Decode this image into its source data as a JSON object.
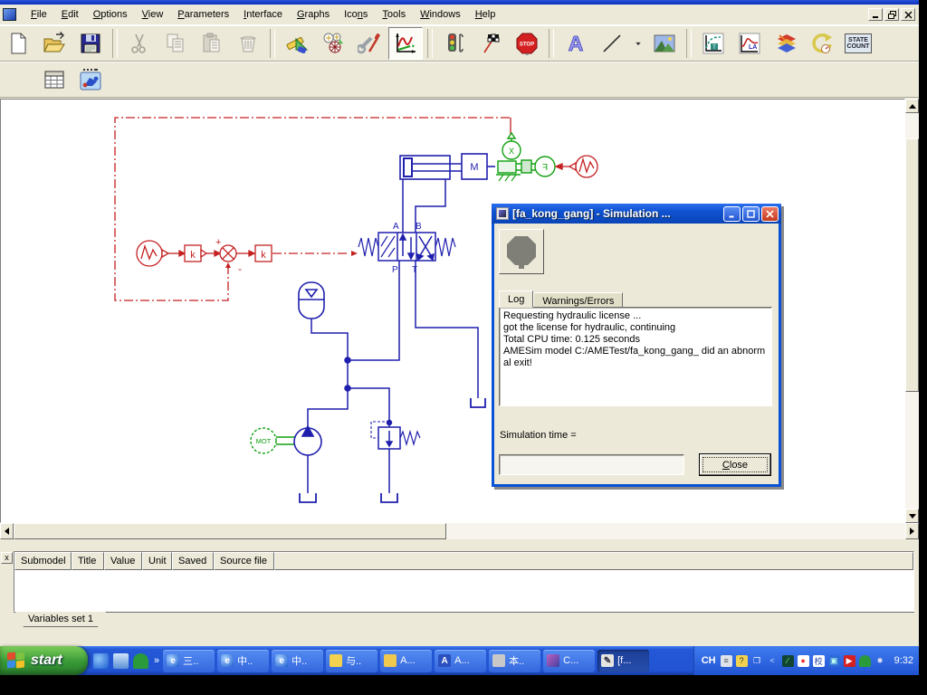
{
  "menu": {
    "items": [
      {
        "label": "File",
        "u": 0
      },
      {
        "label": "Edit",
        "u": 0
      },
      {
        "label": "Options",
        "u": 0
      },
      {
        "label": "View",
        "u": 0
      },
      {
        "label": "Parameters",
        "u": 0
      },
      {
        "label": "Interface",
        "u": 0
      },
      {
        "label": "Graphs",
        "u": 0
      },
      {
        "label": "Icons",
        "u": 3
      },
      {
        "label": "Tools",
        "u": 0
      },
      {
        "label": "Windows",
        "u": 0
      },
      {
        "label": "Help",
        "u": 0
      }
    ]
  },
  "toolbar_main": {
    "buttons": [
      "new",
      "open",
      "save",
      "sep",
      "cut",
      "copy",
      "paste",
      "delete",
      "sep",
      "sketch-mode",
      "submodel-mode",
      "parameter-mode",
      "run-mode",
      "sep",
      "start-run",
      "run-flag",
      "stop",
      "sep",
      "text-tool",
      "line-tool",
      "line-dropdown",
      "image-tool",
      "sep",
      "plot-temporal",
      "plot-linear",
      "cross-results",
      "rewatch",
      "state-count"
    ]
  },
  "toolbar_secondary": {
    "buttons": [
      "plot",
      "table",
      "animation"
    ]
  },
  "toolbar_labels": {
    "stop": "STOP",
    "text_tool": "A",
    "state_count": "STATE COUNT"
  },
  "dialog": {
    "title": "[fa_kong_gang] - Simulation ...",
    "tabs": {
      "0": {
        "label": "Log"
      },
      "1": {
        "label": "Warnings/Errors"
      }
    },
    "log_lines": [
      "Requesting hydraulic license ...",
      "got the license for hydraulic, continuing",
      "Total CPU time: 0.125 seconds",
      "AMESim model C:/AMETest/fa_kong_gang_ did an abnorm",
      "al exit!"
    ],
    "simulation_time_label": "Simulation time =",
    "simulation_time_value": "",
    "close_label": "Close",
    "close_underline": 0
  },
  "bottom_panel": {
    "columns": [
      "Submodel",
      "Title",
      "Value",
      "Unit",
      "Saved",
      "Source file"
    ],
    "tab": "Variables set 1",
    "close_glyph": "x"
  },
  "taskbar": {
    "start_label": "start",
    "quick_launch": [
      "ie",
      "mail",
      "umbrella"
    ],
    "chevron": "»",
    "tasks": [
      {
        "icon": "ie",
        "label": "三..",
        "active": false
      },
      {
        "icon": "ie",
        "label": "中..",
        "active": false
      },
      {
        "icon": "ie",
        "label": "中..",
        "active": false
      },
      {
        "icon": "notes",
        "label": "与..",
        "active": false
      },
      {
        "icon": "folder",
        "label": "A...",
        "active": false
      },
      {
        "icon": "amesim",
        "label": "A...",
        "active": false
      },
      {
        "icon": "computer",
        "label": "本..",
        "active": false
      },
      {
        "icon": "winrar",
        "label": "C...",
        "active": false
      },
      {
        "icon": "sim",
        "label": "[f...",
        "active": true
      }
    ],
    "lang": "CH",
    "tray_icons": [
      "keyboard",
      "help",
      "window-stack",
      "chevron-left",
      "monitor",
      "qq",
      "antivirus",
      "network",
      "media",
      "umbrella",
      "spinner"
    ],
    "clock": "9:32"
  },
  "diagram": {
    "labels": {
      "mass": "M",
      "sensor_x": "X",
      "force": "F",
      "gain1": "k",
      "gain2": "k",
      "motor": "MOT",
      "port_a": "A",
      "port_b": "B",
      "port_p": "P",
      "port_t": "T",
      "plus": "+",
      "minus": "-"
    },
    "colors": {
      "hydraulic": "#1f1fae",
      "mechanical_green": "#10a010",
      "signal_red": "#c42020"
    }
  }
}
